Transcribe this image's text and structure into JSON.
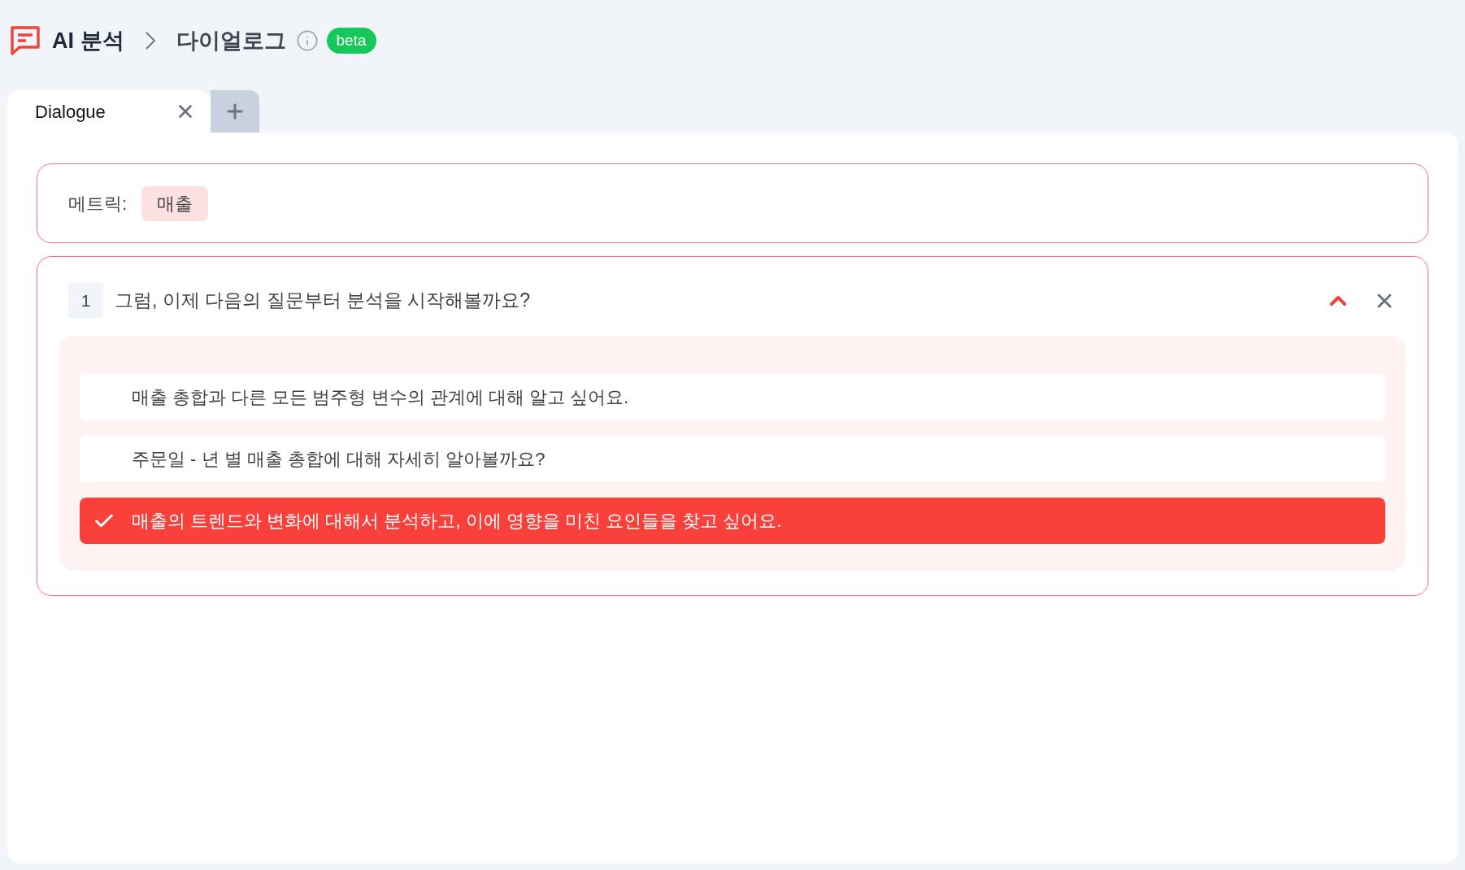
{
  "breadcrumb": [
    {
      "label": "AI 분석"
    },
    {
      "label": "다이얼로그"
    }
  ],
  "badge": "beta",
  "tabs": [
    {
      "label": "Dialogue",
      "selected": true
    }
  ],
  "metric": {
    "label": "메트릭:",
    "value": "매출"
  },
  "question": {
    "number": "1",
    "text": "그럼, 이제 다음의 질문부터 분석을 시작해볼까요?",
    "expanded": true,
    "options": [
      {
        "text": "매출 총합과 다른 모든 범주형 변수의 관계에 대해 알고 싶어요.",
        "selected": false
      },
      {
        "text": "주문일 - 년 별 매출 총합에 대해 자세히 알아볼까요?",
        "selected": false
      },
      {
        "text": "매출의 트렌드와 변화에 대해서 분석하고, 이에 영향을 미친 요인들을 찾고 싶어요.",
        "selected": true
      }
    ]
  }
}
